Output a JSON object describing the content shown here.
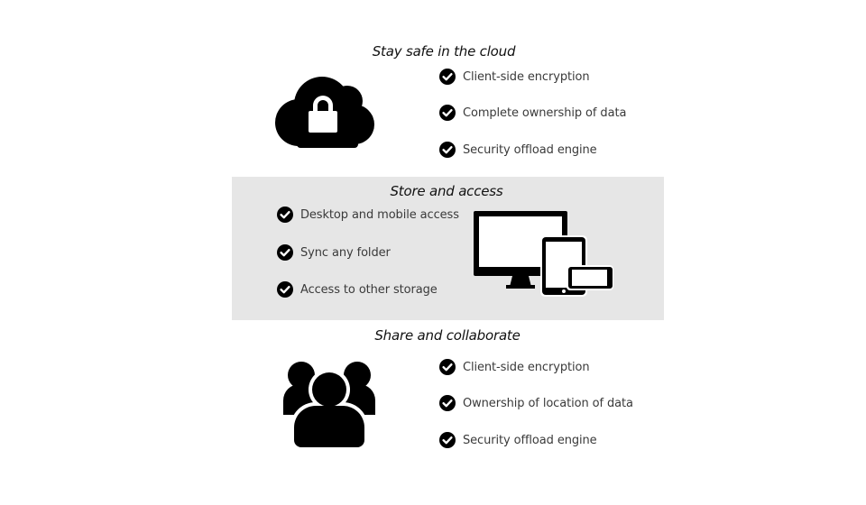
{
  "sections": [
    {
      "title": "Stay safe in the cloud",
      "icon": "cloud-lock-icon",
      "items": [
        "Client-side encryption",
        "Complete ownership of data",
        "Security offload engine"
      ]
    },
    {
      "title": "Store and access",
      "icon": "devices-icon",
      "items": [
        "Desktop and mobile access",
        "Sync any folder",
        "Access to other storage"
      ]
    },
    {
      "title": "Share and collaborate",
      "icon": "group-users-icon",
      "items": [
        "Client-side encryption",
        "Ownership of location of data",
        "Security offload engine"
      ]
    }
  ],
  "colors": {
    "band": "#e6e6e6",
    "icon": "#000000",
    "text": "#3a3a3a"
  }
}
